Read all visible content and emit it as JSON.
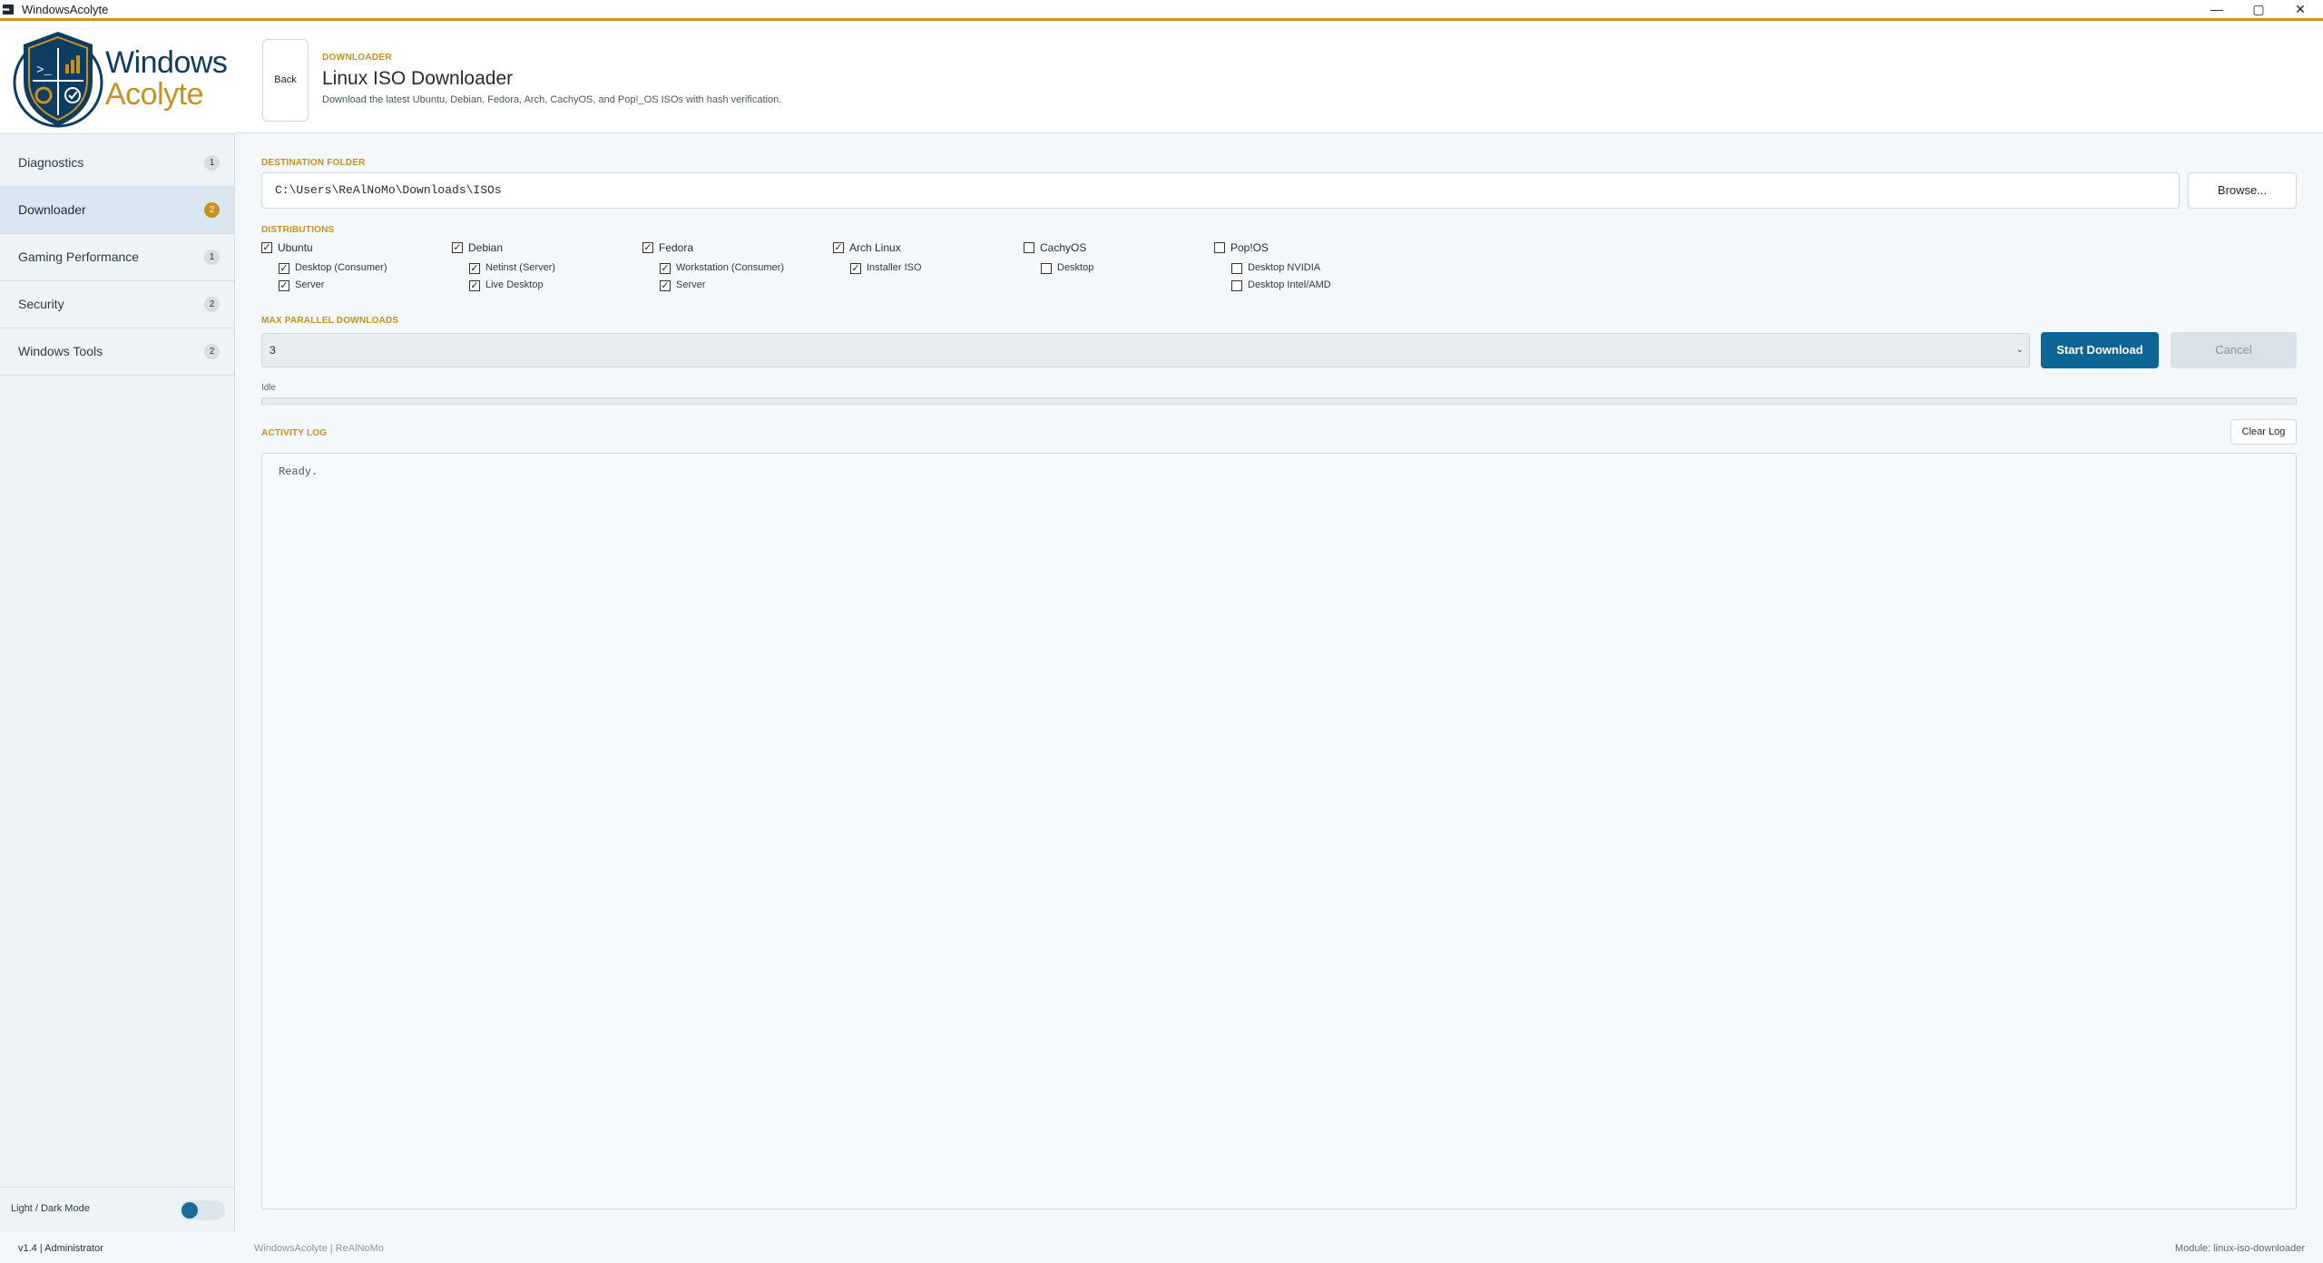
{
  "window": {
    "title": "WindowsAcolyte",
    "minimize": "—",
    "maximize": "▢",
    "close": "✕"
  },
  "brand": {
    "line1": "Windows",
    "line2": "Acolyte",
    "colors": {
      "navy": "#0e3d63",
      "gold": "#c8911e"
    }
  },
  "sidebar": {
    "items": [
      {
        "label": "Diagnostics",
        "badge": "1",
        "active": false
      },
      {
        "label": "Downloader",
        "badge": "2",
        "active": true
      },
      {
        "label": "Gaming Performance",
        "badge": "1",
        "active": false
      },
      {
        "label": "Security",
        "badge": "2",
        "active": false
      },
      {
        "label": "Windows Tools",
        "badge": "2",
        "active": false
      }
    ],
    "theme_label": "Light / Dark Mode",
    "theme_dark": false
  },
  "header": {
    "back_label": "Back",
    "eyebrow": "DOWNLOADER",
    "title": "Linux ISO Downloader",
    "subtitle": "Download the latest Ubuntu, Debian, Fedora, Arch, CachyOS, and Pop!_OS ISOs with hash verification."
  },
  "destination": {
    "label": "DESTINATION FOLDER",
    "value": "C:\\Users\\ReAlNoMo\\Downloads\\ISOs",
    "browse_label": "Browse..."
  },
  "distributions": {
    "label": "DISTRIBUTIONS",
    "items": [
      {
        "name": "Ubuntu",
        "checked": true,
        "variants": [
          {
            "name": "Desktop (Consumer)",
            "checked": true
          },
          {
            "name": "Server",
            "checked": true
          }
        ]
      },
      {
        "name": "Debian",
        "checked": true,
        "variants": [
          {
            "name": "Netinst (Server)",
            "checked": true
          },
          {
            "name": "Live Desktop",
            "checked": true
          }
        ]
      },
      {
        "name": "Fedora",
        "checked": true,
        "variants": [
          {
            "name": "Workstation (Consumer)",
            "checked": true
          },
          {
            "name": "Server",
            "checked": true
          }
        ]
      },
      {
        "name": "Arch Linux",
        "checked": true,
        "variants": [
          {
            "name": "Installer ISO",
            "checked": true
          }
        ]
      },
      {
        "name": "CachyOS",
        "checked": false,
        "variants": [
          {
            "name": "Desktop",
            "checked": false
          }
        ]
      },
      {
        "name": "Pop!OS",
        "checked": false,
        "variants": [
          {
            "name": "Desktop NVIDIA",
            "checked": false
          },
          {
            "name": "Desktop Intel/AMD",
            "checked": false
          }
        ]
      }
    ]
  },
  "parallel": {
    "label": "MAX PARALLEL DOWNLOADS",
    "value": "3",
    "caret": "⌄",
    "start_label": "Start Download",
    "cancel_label": "Cancel"
  },
  "progress": {
    "status": "Idle",
    "fraction": 0
  },
  "activity": {
    "label": "ACTIVITY LOG",
    "clear_label": "Clear Log",
    "log": "Ready."
  },
  "footer": {
    "version": "v1.4  |  Administrator",
    "center": "WindowsAcolyte  |  ReAlNoMo",
    "module": "Module: linux-iso-downloader"
  },
  "colors": {
    "accent": "#c8911e",
    "primary": "#0d6596",
    "active_nav": "#dbe7f0"
  }
}
